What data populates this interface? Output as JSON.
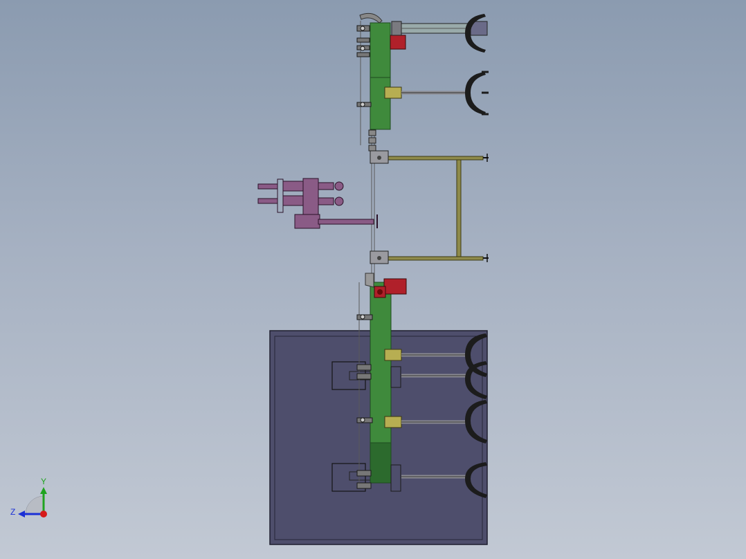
{
  "triad": {
    "y_label": "Y",
    "z_label": "Z",
    "y_color": "#1fa31f",
    "z_color": "#1a2fd6",
    "x_color": "#d61a1a"
  },
  "colors": {
    "conveyor_green": "#3f8a3c",
    "conveyor_dark": "#2c6a2d",
    "base_plate": "#4e4e6c",
    "frame_olive": "#8e8a4a",
    "robot_purple": "#8a5b86",
    "motor_red": "#b0202a",
    "clamp_black": "#1c1c1c",
    "bracket_yellow": "#b7ae52",
    "rod_gray": "#8b8b92"
  }
}
